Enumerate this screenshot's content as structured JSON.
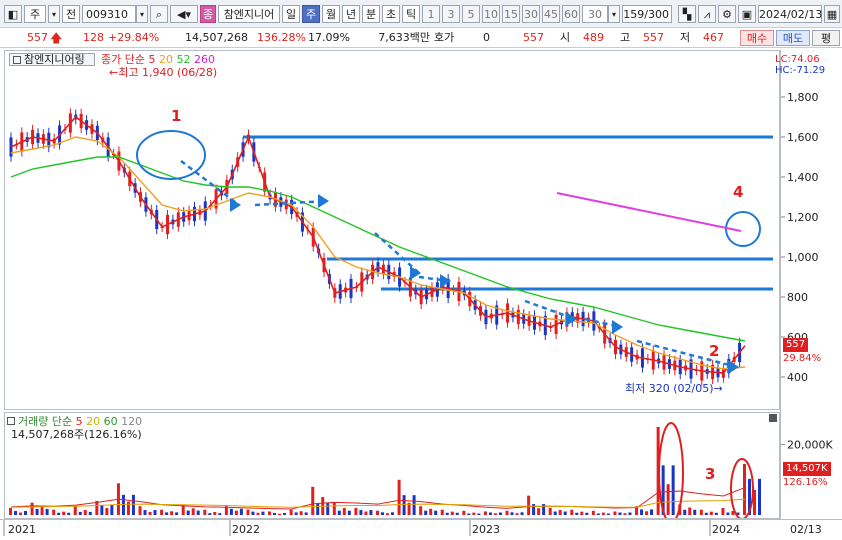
{
  "toolbar": {
    "mode_label": "주",
    "prefix_label": "전",
    "stock_code": "009310",
    "stock_badge": "종",
    "stock_name": "참엔지니어",
    "period_tabs": [
      "일",
      "주",
      "월",
      "년",
      "분",
      "초",
      "틱"
    ],
    "active_period": "주",
    "interval_buttons": [
      "1",
      "3",
      "5",
      "10",
      "15",
      "30",
      "45",
      "60"
    ],
    "interval_value": "30",
    "count_value": "159",
    "count_total": "/300",
    "date_value": "2024/02/13"
  },
  "infobar": {
    "price": "557",
    "change": "128",
    "change_pct": "+29.84%",
    "volume": "14,507,268",
    "vol_ratio": "136.28%",
    "turnover": "17.09%",
    "amount": "7,633백만",
    "hoga_label": "호가",
    "hoga_value": "0",
    "hoga_price": "557",
    "open_label": "시",
    "open": "489",
    "high_label": "고",
    "high": "557",
    "low_label": "저",
    "low": "467",
    "buy_label": "매수",
    "sell_label": "매도",
    "eval_label": "평"
  },
  "price_pane": {
    "tab_label": "참엔지니어링",
    "legend_title": "종가 단순",
    "ma_periods": [
      "5",
      "20",
      "52",
      "260"
    ],
    "ma_colors": [
      "#e02020",
      "#f0a020",
      "#22c422",
      "#d020d0"
    ],
    "max_note": "최고 1,940 (06/28)",
    "min_note": "최저 320 (02/05)",
    "lc_label": "LC:74.06",
    "hc_label": "HC:-71.29",
    "current_price_tag": "557",
    "current_pct_tag": "29.84%",
    "annotations": [
      "1",
      "2",
      "4"
    ]
  },
  "volume_pane": {
    "legend_title": "거래량 단순",
    "ma_periods": [
      "5",
      "20",
      "60",
      "120"
    ],
    "info": "14,507,268주(126.16%)",
    "current_tag": "14,507K",
    "current_pct_tag": "126.16%",
    "annotation": "3"
  },
  "xaxis": {
    "labels": [
      "2021",
      "2022",
      "2023",
      "2024"
    ],
    "right_label": "02/13"
  },
  "chart_data": [
    {
      "type": "candlestick",
      "title": "참엔지니어링",
      "x": [
        "2021",
        "2022",
        "2023",
        "2024"
      ],
      "y_ticks": [
        400,
        600,
        800,
        1000,
        1200,
        1400,
        1600,
        1800
      ],
      "ylim": [
        250,
        1900
      ],
      "grid": false,
      "series": [
        {
          "name": "5",
          "values": [
            1550,
            1600,
            1580,
            1700,
            1620,
            1480,
            1300,
            1150,
            1200,
            1230,
            1350,
            1600,
            1300,
            1250,
            1100,
            820,
            850,
            950,
            900,
            800,
            850,
            820,
            700,
            720,
            680,
            650,
            700,
            680,
            550,
            500,
            480,
            450,
            430,
            420,
            557
          ]
        },
        {
          "name": "20",
          "values": [
            1520,
            1540,
            1560,
            1600,
            1580,
            1500,
            1380,
            1260,
            1230,
            1240,
            1280,
            1320,
            1300,
            1260,
            1150,
            1000,
            950,
            920,
            900,
            860,
            840,
            820,
            760,
            730,
            710,
            690,
            680,
            670,
            610,
            560,
            520,
            490,
            460,
            440,
            450
          ]
        },
        {
          "name": "52",
          "values": [
            1400,
            1440,
            1460,
            1480,
            1500,
            1500,
            1460,
            1420,
            1380,
            1360,
            1350,
            1350,
            1330,
            1300,
            1250,
            1200,
            1150,
            1100,
            1050,
            1010,
            970,
            930,
            890,
            850,
            820,
            790,
            770,
            750,
            720,
            690,
            660,
            640,
            620,
            600,
            580
          ]
        }
      ],
      "horizontal_lines": [
        1600,
        990,
        840
      ],
      "max": {
        "value": 1940,
        "date": "06/28"
      },
      "min": {
        "value": 320,
        "date": "02/05"
      },
      "last": {
        "value": 557,
        "change_pct": "29.84%"
      }
    },
    {
      "type": "bar",
      "title": "거래량",
      "x": [
        "2021",
        "2022",
        "2023",
        "2024"
      ],
      "y_ticks": [
        10000,
        20000
      ],
      "y_tick_labels": [
        "",
        "20,000K"
      ],
      "ylim": [
        0,
        25000
      ],
      "series": [
        {
          "name": "volume",
          "values": [
            2000,
            3500,
            1500,
            2500,
            4000,
            9000,
            2500,
            1500,
            3000,
            1500,
            2500,
            1500,
            1000,
            1500,
            8000,
            3500,
            2000,
            1200,
            10000,
            2500,
            1500,
            1200,
            1000,
            1200,
            5500,
            2000,
            1500,
            1200,
            1000,
            2500,
            25000,
            3000,
            1500,
            2000,
            14507
          ]
        },
        {
          "name": "5",
          "values": [
            2300,
            2600,
            2500,
            2800,
            3600,
            4500,
            3800,
            2900,
            2600,
            2300,
            2200,
            2000,
            1800,
            1700,
            3200,
            3600,
            3400,
            3100,
            4200,
            3800,
            3100,
            2700,
            2200,
            1900,
            2400,
            2500,
            2400,
            2200,
            2000,
            2100,
            6500,
            6800,
            6000,
            5400,
            7800
          ]
        },
        {
          "name": "20",
          "values": [
            2200,
            2300,
            2400,
            2500,
            2700,
            3000,
            3100,
            3000,
            2900,
            2800,
            2700,
            2500,
            2300,
            2200,
            2400,
            2600,
            2700,
            2700,
            3000,
            3100,
            3000,
            2900,
            2700,
            2500,
            2500,
            2500,
            2400,
            2300,
            2200,
            2200,
            3600,
            3900,
            4000,
            4100,
            4500
          ]
        }
      ],
      "last": {
        "value": "14,507K",
        "ratio": "126.16%"
      }
    }
  ]
}
